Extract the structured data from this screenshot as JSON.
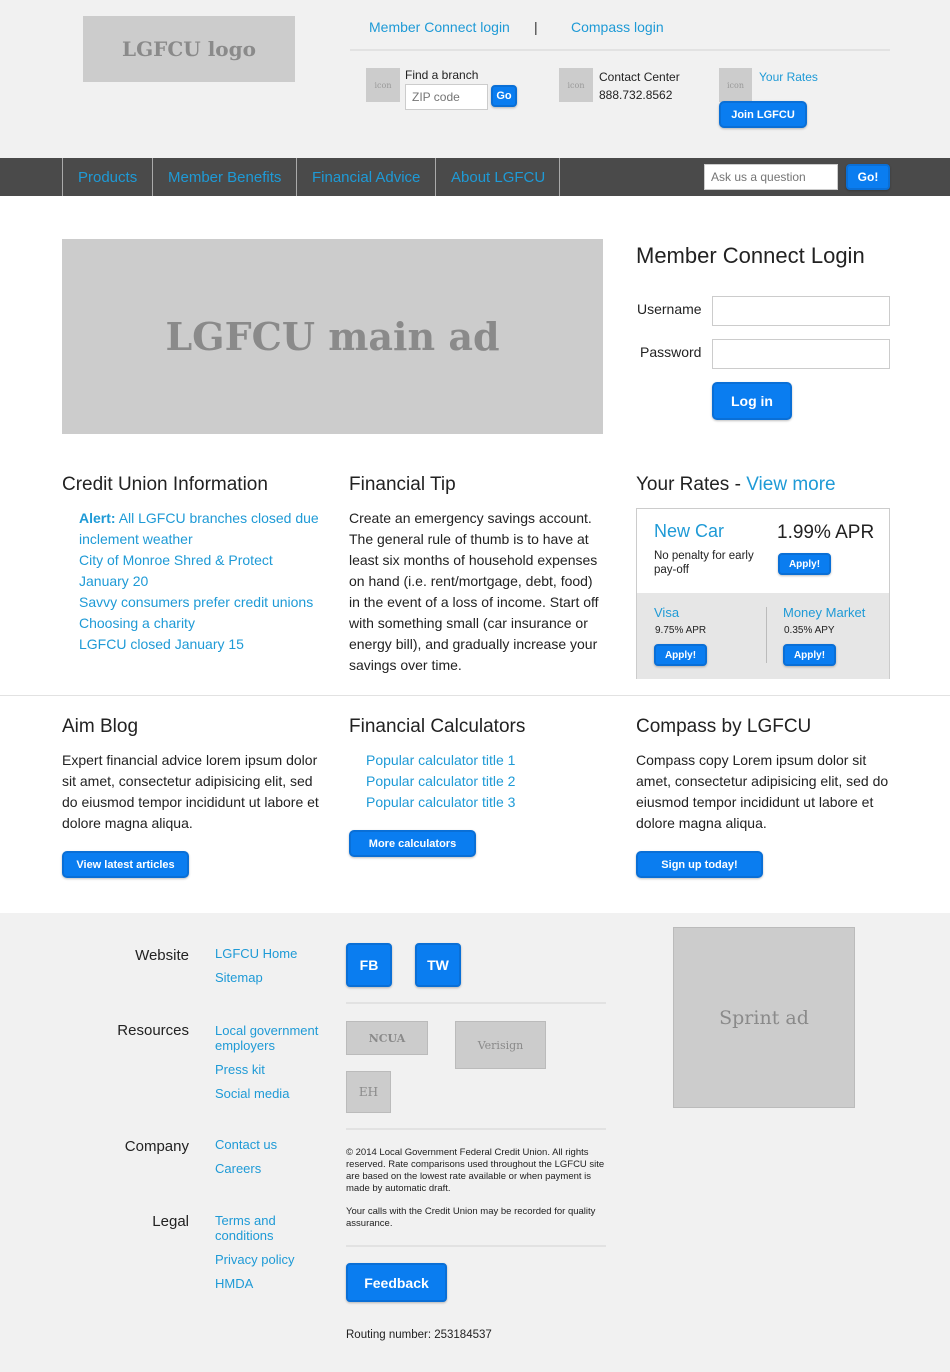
{
  "header": {
    "logo_text": "LGFCU logo",
    "member_connect_login": "Member Connect login",
    "separator": "|",
    "compass_login": "Compass login",
    "find_branch_label": "Find a branch",
    "zip_placeholder": "ZIP code",
    "zip_go": "Go",
    "contact_center_label": "Contact Center",
    "contact_phone": "888.732.8562",
    "your_rates_link": "Your Rates",
    "join_button": "Join LGFCU",
    "icon_placeholder": "icon"
  },
  "nav": {
    "items": [
      "Products",
      "Member Benefits",
      "Financial Advice",
      "About LGFCU"
    ],
    "ask_placeholder": "Ask us a question",
    "ask_go": "Go!"
  },
  "hero": {
    "main_ad_text": "LGFCU main ad",
    "login_title": "Member Connect Login",
    "username_label": "Username",
    "password_label": "Password",
    "login_button": "Log in"
  },
  "credit_union_info": {
    "title": "Credit Union Information",
    "alert_prefix": "Alert:",
    "items": [
      "All LGFCU branches closed due inclement weather",
      "City of Monroe Shred & Protect January 20",
      "Savvy consumers prefer credit unions",
      "Choosing a charity",
      "LGFCU closed January 15"
    ]
  },
  "financial_tip": {
    "title": "Financial Tip",
    "text": "Create an emergency savings account. The general rule of thumb is to have at least six months of household expenses on hand (i.e. rent/mortgage, debt, food) in the event of a loss of income. Start off with something small (car insurance or energy bill), and gradually increase your savings over time."
  },
  "rates": {
    "title": "Your Rates -",
    "view_more": "View more",
    "featured_name": "New Car",
    "featured_rate": "1.99% APR",
    "featured_note": "No penalty for early pay-off",
    "apply_label": "Apply!",
    "visa_name": "Visa",
    "visa_rate": "9.75% APR",
    "mm_name": "Money Market",
    "mm_rate": "0.35% APY"
  },
  "aim_blog": {
    "title": "Aim Blog",
    "text": "Expert financial advice lorem ipsum dolor sit amet, consectetur adipisicing elit, sed do eiusmod tempor incididunt ut labore et dolore magna aliqua.",
    "button": "View latest articles"
  },
  "calculators": {
    "title": "Financial Calculators",
    "items": [
      "Popular calculator title 1",
      "Popular calculator title 2",
      "Popular calculator title 3"
    ],
    "button": "More calculators"
  },
  "compass": {
    "title": "Compass by LGFCU",
    "text": "Compass copy Lorem ipsum dolor sit amet, consectetur adipisicing elit, sed do eiusmod tempor incididunt ut labore et dolore magna aliqua.",
    "button": "Sign up today!"
  },
  "footer": {
    "website_head": "Website",
    "website_links": [
      "LGFCU Home",
      "Sitemap"
    ],
    "resources_head": "Resources",
    "resources_links": [
      "Local government employers",
      "Press kit",
      "Social media"
    ],
    "company_head": "Company",
    "company_links": [
      "Contact us",
      "Careers"
    ],
    "legal_head": "Legal",
    "legal_links": [
      "Terms and conditions",
      "Privacy policy",
      "HMDA"
    ],
    "fb": "FB",
    "tw": "TW",
    "ncua": "NCUA",
    "verisign": "Verisign",
    "eh": "EH",
    "copyright": "© 2014 Local Government Federal Credit Union. All rights reserved. Rate comparisons used throughout the LGFCU site are based on the lowest rate available or when payment is made by automatic draft.",
    "calls_note": "Your calls with the Credit Union may be recorded for quality assurance.",
    "feedback": "Feedback",
    "routing": "Routing number: 253184537",
    "sprint_ad": "Sprint ad"
  }
}
